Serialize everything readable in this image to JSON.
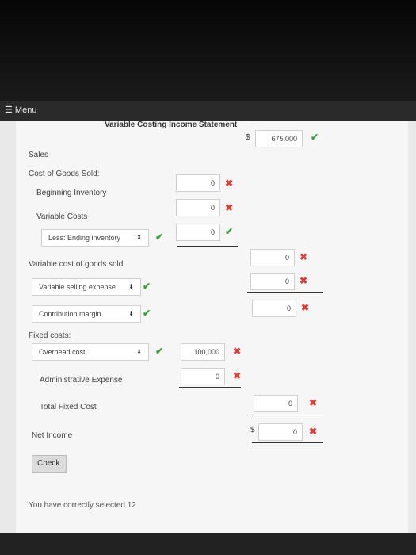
{
  "menu": {
    "label": "Menu"
  },
  "statement": {
    "title": "Variable Costing Income Statement",
    "sales_label": "Sales",
    "sales_currency": "$",
    "sales_value": "675,000",
    "cogs_label": "Cost of Goods Sold:",
    "beginning_inventory_label": "Beginning Inventory",
    "beginning_inventory_value": "0",
    "variable_costs_label": "Variable Costs",
    "variable_costs_value": "0",
    "ending_inventory_select": "Less: Ending inventory",
    "ending_inventory_value": "0",
    "vcogs_label": "Variable cost of goods sold",
    "vcogs_value": "0",
    "variable_selling_select": "Variable selling expense",
    "variable_selling_value": "0",
    "contribution_margin_select": "Contribution margin",
    "contribution_margin_value": "0",
    "fixed_costs_label": "Fixed costs:",
    "overhead_select": "Overhead cost",
    "overhead_value": "100,000",
    "admin_label": "Administrative Expense",
    "admin_value": "0",
    "total_fixed_label": "Total Fixed Cost",
    "total_fixed_value": "0",
    "net_income_label": "Net Income",
    "net_income_currency": "$",
    "net_income_value": "0"
  },
  "check_button": "Check",
  "feedback": "You have correctly selected 12.",
  "icons": {
    "check": "✔",
    "cross": "✖",
    "select_arrows": "⬍"
  },
  "colors": {
    "correct": "#3aa23a",
    "incorrect": "#d8403a"
  }
}
